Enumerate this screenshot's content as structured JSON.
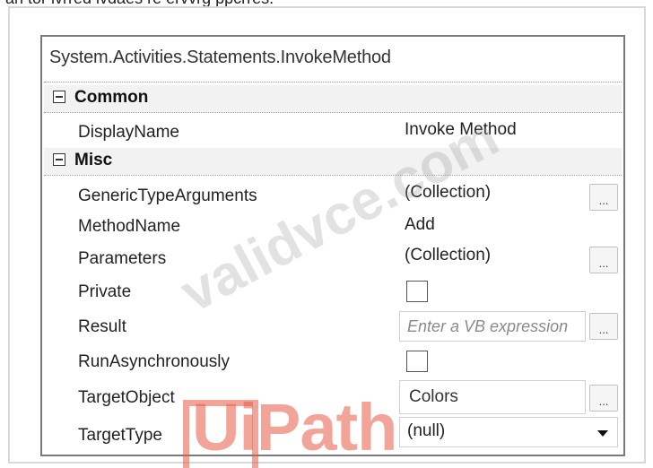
{
  "page": {
    "top_text": "an tor lvrred ivdaes re ervvrg ppcrres."
  },
  "panel": {
    "title": "System.Activities.Statements.InvokeMethod",
    "categories": [
      {
        "label": "Common"
      },
      {
        "label": "Misc"
      }
    ],
    "properties": {
      "display_name": {
        "name": "DisplayName",
        "value": "Invoke Method"
      },
      "generic_type_arguments": {
        "name": "GenericTypeArguments",
        "value": "(Collection)",
        "button": "..."
      },
      "method_name": {
        "name": "MethodName",
        "value": "Add"
      },
      "parameters": {
        "name": "Parameters",
        "value": "(Collection)",
        "button": "..."
      },
      "private": {
        "name": "Private",
        "checked": false
      },
      "result": {
        "name": "Result",
        "placeholder": "Enter a VB expression",
        "button": "..."
      },
      "run_asynchronously": {
        "name": "RunAsynchronously",
        "checked": false
      },
      "target_object": {
        "name": "TargetObject",
        "value": "Colors",
        "button": "..."
      },
      "target_type": {
        "name": "TargetType",
        "value": "(null)"
      }
    }
  },
  "overlay": {
    "watermark": "validvce.com",
    "logo_text": "UiPath"
  },
  "icons": {
    "collapse": "collapse-icon",
    "dropdown": "chevron-down-icon"
  }
}
